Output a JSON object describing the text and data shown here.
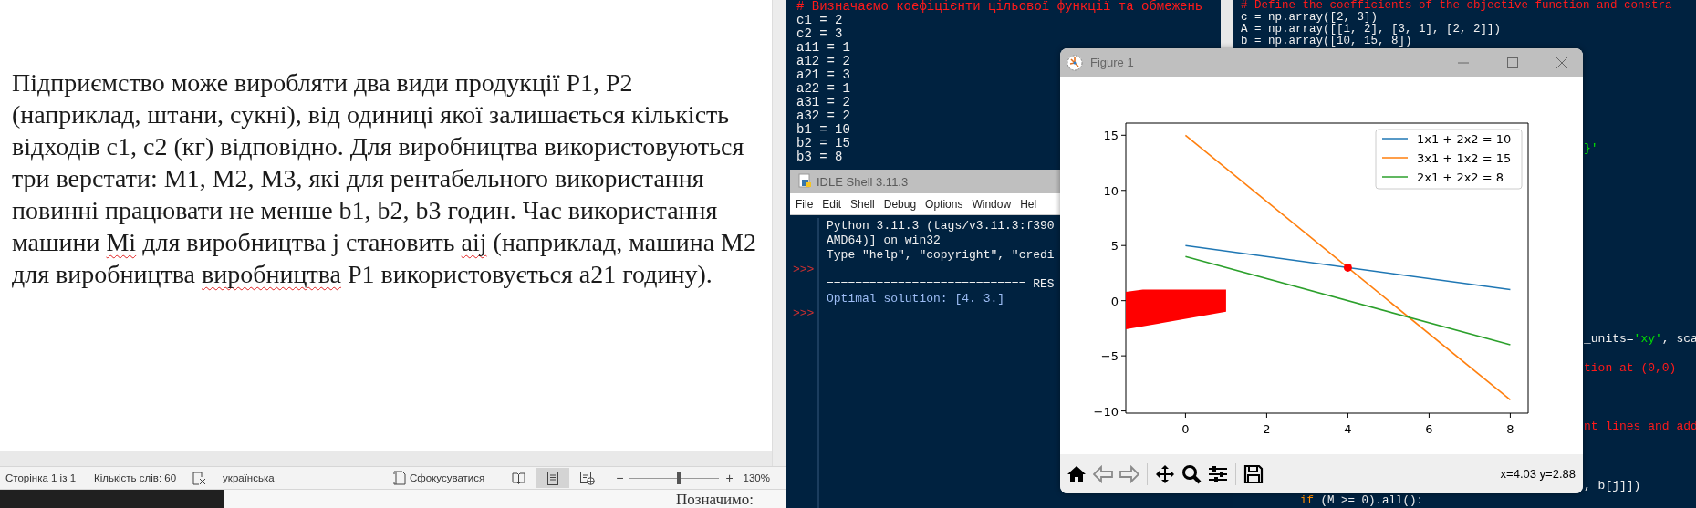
{
  "document": {
    "paragraph": [
      {
        "text": "Підприємство може виробляти два види продукції Р1, Р2 (наприклад, штани, сукні), від одиниці якої залишається кількість відходів с1, с2 (кг) відповідно. Для виробництва використовуються три верстати: М1, М2, М3, які для рентабельного використання повинні працювати не менше b1, b2, b3 годин. Час використання машини ",
        "misspelled": false
      },
      {
        "text": "Мі",
        "misspelled": true
      },
      {
        "text": " для виробництва j становить ",
        "misspelled": false
      },
      {
        "text": "aij",
        "misspelled": true
      },
      {
        "text": " (наприклад, машина М2 для виробництва ",
        "misspelled": false
      },
      {
        "text": "виробництва",
        "misspelled": true
      },
      {
        "text": " Р1 використовується а21 годину).",
        "misspelled": false
      }
    ],
    "next_page_text": "Позначимо:"
  },
  "status_bar": {
    "page": "Сторінка 1 із 1",
    "words": "Кількість слів: 60",
    "language": "українська",
    "focus": "Сфокусуватися",
    "view_modes": [
      {
        "kind": "read",
        "selected": false
      },
      {
        "kind": "print",
        "selected": true
      },
      {
        "kind": "web",
        "selected": false
      }
    ],
    "zoom_out": "−",
    "zoom": {
      "level": 0.55
    },
    "zoom_in": "+",
    "zoom_value": "130%"
  },
  "editor_left": {
    "lines": [
      {
        "kind": "comment",
        "text": "# Визначаємо коефіцієнти цільової функції та обмежень"
      },
      {
        "kind": "code",
        "text": "c1 = 2"
      },
      {
        "kind": "code",
        "text": "c2 = 3"
      },
      {
        "kind": "code",
        "text": "a11 = 1"
      },
      {
        "kind": "code",
        "text": "a12 = 2"
      },
      {
        "kind": "code",
        "text": "a21 = 3"
      },
      {
        "kind": "code",
        "text": "a22 = 1"
      },
      {
        "kind": "code",
        "text": "a31 = 2"
      },
      {
        "kind": "code",
        "text": "a32 = 2"
      },
      {
        "kind": "code",
        "text": "b1 = 10"
      },
      {
        "kind": "code",
        "text": "b2 = 15"
      },
      {
        "kind": "code",
        "text": "b3 = 8"
      }
    ]
  },
  "editor_right": {
    "top_lines": [
      [
        {
          "kind": "comment",
          "text": "# Define the coefficients of the objective function and constra"
        }
      ],
      [
        {
          "kind": "code",
          "text": "c = np.array([2, 3])"
        }
      ],
      [
        {
          "kind": "code",
          "text": "A = np.array([[1, 2], [3, 1], [2, 2]])"
        }
      ],
      [
        {
          "kind": "code",
          "text": "b = np.array([10, 15, 8])"
        }
      ]
    ],
    "line_ends": [
      [
        {
          "kind": "string",
          "text": "}'"
        }
      ],
      [
        {
          "kind": "code",
          "text": "_units="
        },
        {
          "kind": "string",
          "text": "'xy'"
        },
        {
          "kind": "code",
          "text": ", sca"
        }
      ],
      [
        {
          "kind": "comment",
          "text": "tion at (0,0)"
        }
      ],
      [
        {
          "kind": "comment",
          "text": "nt lines and add"
        }
      ],
      [
        {
          "kind": "code",
          "text": ", b[j]])"
        }
      ]
    ],
    "bottom_line": [
      {
        "kind": "keyword",
        "text": "if"
      },
      {
        "kind": "code",
        "text": " (M >= 0).all():"
      }
    ]
  },
  "shell": {
    "title": "IDLE Shell 3.11.3",
    "menu": [
      "File",
      "Edit",
      "Shell",
      "Debug",
      "Options",
      "Window",
      "Hel"
    ],
    "lines": [
      {
        "kind": "banner",
        "text": "Python 3.11.3 (tags/v3.11.3:f390"
      },
      {
        "kind": "banner",
        "text": "AMD64)] on win32"
      },
      {
        "kind": "banner",
        "text": "Type \"help\", \"copyright\", \"credi"
      },
      {
        "prompt": ">>>"
      },
      {
        "kind": "banner",
        "text": "============================ RES"
      },
      {
        "kind": "output",
        "text": "Optimal solution: [4. 3.]"
      },
      {
        "prompt": ">>>"
      }
    ]
  },
  "figure": {
    "title": "Figure 1",
    "toolbar": [
      {
        "kind": "home",
        "disabled": false
      },
      {
        "kind": "back",
        "disabled": true
      },
      {
        "kind": "forward",
        "disabled": true
      },
      {
        "kind": "separator"
      },
      {
        "kind": "pan",
        "disabled": false
      },
      {
        "kind": "zoom",
        "disabled": false
      },
      {
        "kind": "configure",
        "disabled": false
      },
      {
        "kind": "separator"
      },
      {
        "kind": "save",
        "disabled": false
      }
    ],
    "coordinates": "x=4.03 y=2.88",
    "chart_data": {
      "type": "line",
      "x": [
        0,
        8
      ],
      "series": [
        {
          "name": "1x1 + 2x2 = 10",
          "color": "#1f77b4",
          "values": [
            5,
            1
          ]
        },
        {
          "name": "3x1 + 1x2 = 15",
          "color": "#ff7f0e",
          "values": [
            15,
            -9
          ]
        },
        {
          "name": "2x1 + 2x2 = 8",
          "color": "#2ca02c",
          "values": [
            4,
            -4
          ]
        }
      ],
      "xlim": [
        -1.47,
        8.44
      ],
      "ylim": [
        -10.2,
        16.1
      ],
      "xticks": [
        0,
        2,
        4,
        6,
        8
      ],
      "yticks": [
        {
          "value": -10,
          "label": "−10"
        },
        {
          "value": -5,
          "label": "−5"
        },
        0,
        5,
        10,
        15
      ],
      "legend": "upper right"
    }
  }
}
